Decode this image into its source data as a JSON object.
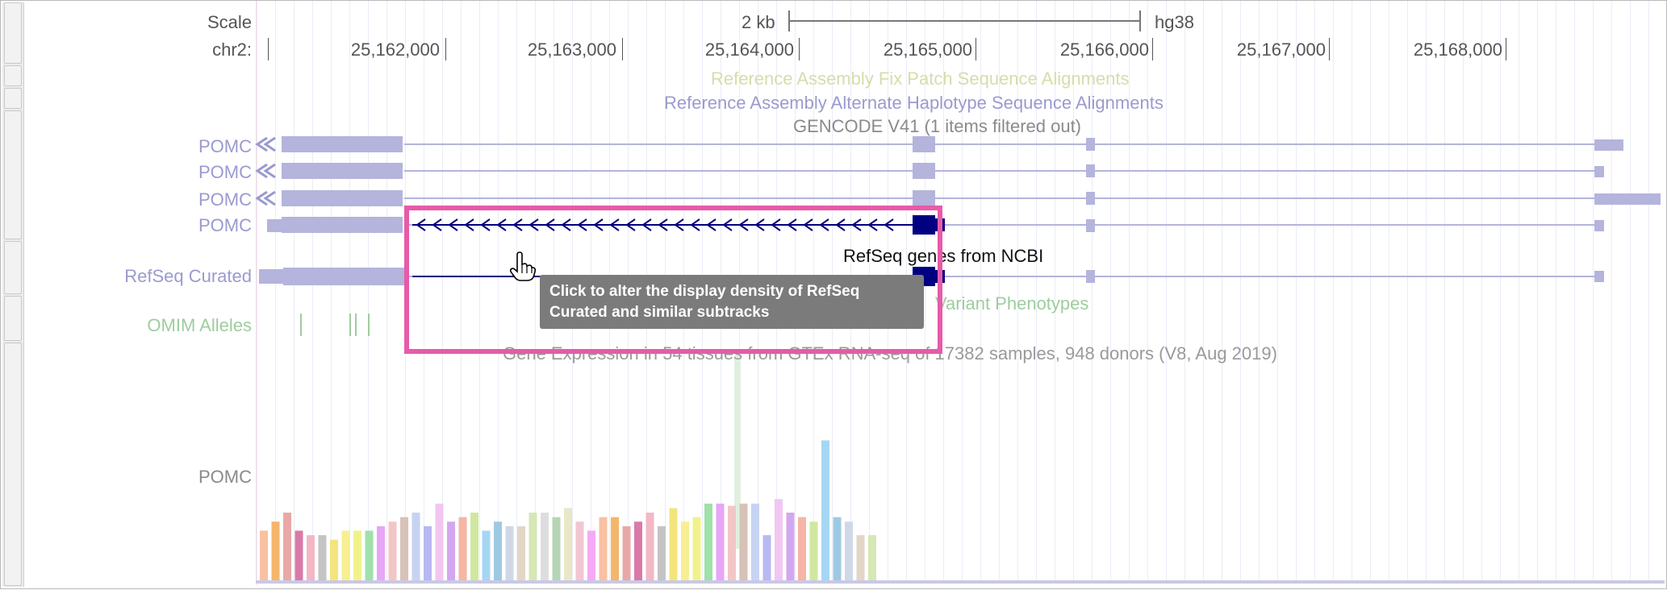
{
  "ruler": {
    "scale_label": "Scale",
    "chrom_label": "chr2:",
    "scalebar_label": "2 kb",
    "assembly": "hg38",
    "ticks": [
      "25,162,000",
      "25,163,000",
      "25,164,000",
      "25,165,000",
      "25,166,000",
      "25,167,000",
      "25,168,000"
    ]
  },
  "tracks": {
    "fix_patch": "Reference Assembly Fix Patch Sequence Alignments",
    "alt_haplotype": "Reference Assembly Alternate Haplotype Sequence Alignments",
    "gencode": "GENCODE V41 (1 items filtered out)",
    "gencode_items": [
      "POMC",
      "POMC",
      "POMC",
      "POMC"
    ],
    "refseq_title": "RefSeq genes from NCBI",
    "refseq_label": "RefSeq Curated",
    "omim_title": "Variant Phenotypes",
    "omim_label": "OMIM Alleles",
    "gtex_title": "Gene Expression in 54 tissues from GTEx RNA-seq of 17382 samples, 948 donors (V8, Aug 2019)",
    "gtex_label": "POMC"
  },
  "tooltip": {
    "line1": "Click to alter the display density of RefSeq",
    "line2": "Curated and similar subtracks"
  },
  "colors": {
    "gencode": "#b4b4dc",
    "refseq_exon": "#000080",
    "highlight": "#e85aa9",
    "fix_patch": "#d8dcaa",
    "alt_haplotype": "#9a9ad0",
    "omim": "#9fcc9f"
  },
  "gtex_values": [
    0.22,
    0.26,
    0.3,
    0.22,
    0.2,
    0.2,
    0.18,
    0.22,
    0.22,
    0.22,
    0.24,
    0.26,
    0.28,
    0.3,
    0.24,
    0.34,
    0.26,
    0.28,
    0.3,
    0.22,
    0.26,
    0.24,
    0.24,
    0.3,
    0.3,
    0.28,
    0.32,
    0.26,
    0.22,
    0.28,
    0.28,
    0.24,
    0.26,
    0.3,
    0.24,
    0.32,
    0.26,
    0.28,
    0.34,
    0.34,
    0.33,
    0.34,
    0.34,
    0.2,
    0.36,
    0.3,
    0.28,
    0.26,
    0.62,
    0.28,
    0.26,
    0.2,
    0.2
  ]
}
